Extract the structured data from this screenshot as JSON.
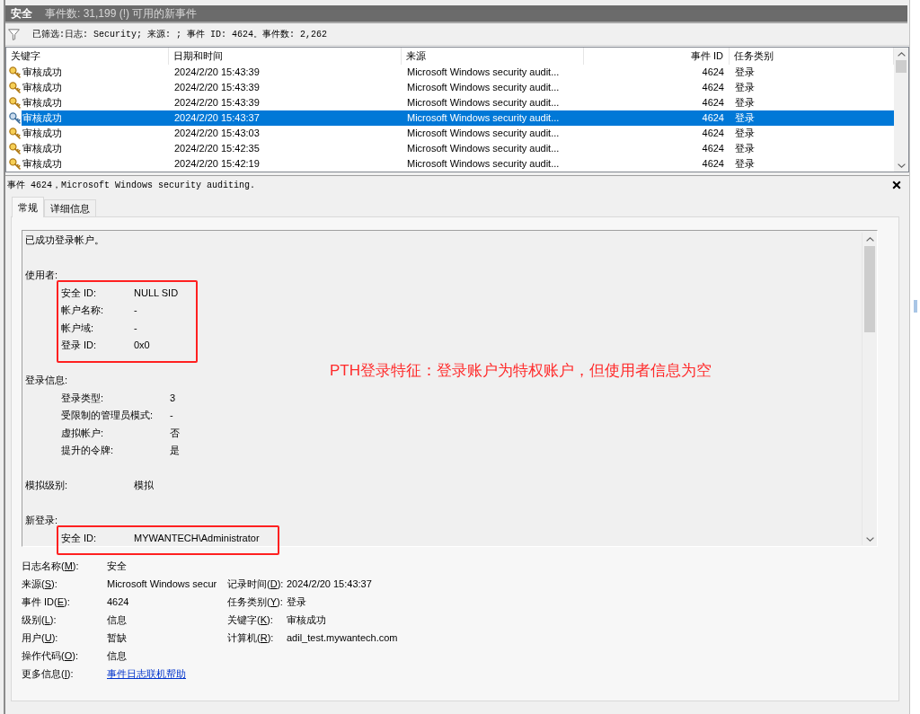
{
  "header": {
    "title": "安全",
    "summary": "事件数: 31,199 (!) 可用的新事件"
  },
  "filter": {
    "text": "已筛选:日志: Security; 来源: ; 事件 ID: 4624。事件数: 2,262"
  },
  "table": {
    "columns": [
      "关键字",
      "日期和时间",
      "来源",
      "事件 ID",
      "任务类别"
    ],
    "rows": [
      {
        "keyword": "审核成功",
        "date": "2024/2/20 15:43:39",
        "source": "Microsoft Windows security audit...",
        "event_id": "4624",
        "task": "登录",
        "selected": false
      },
      {
        "keyword": "审核成功",
        "date": "2024/2/20 15:43:39",
        "source": "Microsoft Windows security audit...",
        "event_id": "4624",
        "task": "登录",
        "selected": false
      },
      {
        "keyword": "审核成功",
        "date": "2024/2/20 15:43:39",
        "source": "Microsoft Windows security audit...",
        "event_id": "4624",
        "task": "登录",
        "selected": false
      },
      {
        "keyword": "审核成功",
        "date": "2024/2/20 15:43:37",
        "source": "Microsoft Windows security audit...",
        "event_id": "4624",
        "task": "登录",
        "selected": true
      },
      {
        "keyword": "审核成功",
        "date": "2024/2/20 15:43:03",
        "source": "Microsoft Windows security audit...",
        "event_id": "4624",
        "task": "登录",
        "selected": false
      },
      {
        "keyword": "审核成功",
        "date": "2024/2/20 15:42:35",
        "source": "Microsoft Windows security audit...",
        "event_id": "4624",
        "task": "登录",
        "selected": false
      },
      {
        "keyword": "审核成功",
        "date": "2024/2/20 15:42:19",
        "source": "Microsoft Windows security audit...",
        "event_id": "4624",
        "task": "登录",
        "selected": false
      }
    ]
  },
  "detail": {
    "title": "事件 4624，Microsoft Windows security auditing.",
    "tabs": [
      {
        "label": "常规",
        "selected": true
      },
      {
        "label": "详细信息",
        "selected": false
      }
    ],
    "message": {
      "intro": "已成功登录帐户。",
      "sections": [
        {
          "heading": "使用者:",
          "highlighted": true,
          "fields": [
            {
              "label": "安全 ID:",
              "value": "NULL SID"
            },
            {
              "label": "帐户名称:",
              "value": "-"
            },
            {
              "label": "帐户域:",
              "value": "-"
            },
            {
              "label": "登录 ID:",
              "value": "0x0"
            }
          ]
        },
        {
          "heading": "登录信息:",
          "highlighted": false,
          "fields": [
            {
              "label": "登录类型:",
              "value": "3"
            },
            {
              "label": "受限制的管理员模式:",
              "value": "-"
            },
            {
              "label": "虚拟帐户:",
              "value": "否"
            },
            {
              "label": "提升的令牌:",
              "value": "是"
            }
          ]
        },
        {
          "heading": "模拟级别:",
          "value": "模拟",
          "highlighted": false
        },
        {
          "heading": "新登录:",
          "highlighted": true,
          "fields": [
            {
              "label": "安全 ID:",
              "value": "MYWANTECH\\Administrator"
            }
          ]
        }
      ]
    },
    "annotation": "PTH登录特征：登录账户为特权账户，但使用者信息为空",
    "properties": [
      {
        "left": {
          "label_start": "日志名称(",
          "access_key": "M",
          "label_end": "):",
          "value": "安全",
          "kind": "text"
        }
      },
      {
        "left": {
          "label_start": "来源(",
          "access_key": "S",
          "label_end": "):",
          "value": "Microsoft Windows secur",
          "kind": "text"
        },
        "right": {
          "label_start": "记录时间(",
          "access_key": "D",
          "label_end": "):",
          "value": "2024/2/20 15:43:37",
          "kind": "text"
        }
      },
      {
        "left": {
          "label_start": "事件 ID(",
          "access_key": "E",
          "label_end": "):",
          "value": "4624",
          "kind": "text"
        },
        "right": {
          "label_start": "任务类别(",
          "access_key": "Y",
          "label_end": "):",
          "value": "登录",
          "kind": "text"
        }
      },
      {
        "left": {
          "label_start": "级别(",
          "access_key": "L",
          "label_end": "):",
          "value": "信息",
          "kind": "text"
        },
        "right": {
          "label_start": "关键字(",
          "access_key": "K",
          "label_end": "):",
          "value": "审核成功",
          "kind": "text"
        }
      },
      {
        "left": {
          "label_start": "用户(",
          "access_key": "U",
          "label_end": "):",
          "value": "暂缺",
          "kind": "text"
        },
        "right": {
          "label_start": "计算机(",
          "access_key": "R",
          "label_end": "):",
          "value": "adil_test.mywantech.com",
          "kind": "text"
        }
      },
      {
        "left": {
          "label_start": "操作代码(",
          "access_key": "O",
          "label_end": "):",
          "value": "信息",
          "kind": "text"
        }
      },
      {
        "left": {
          "label_start": "更多信息(",
          "access_key": "I",
          "label_end": "):",
          "value": "事件日志联机帮助",
          "kind": "link"
        }
      }
    ]
  }
}
